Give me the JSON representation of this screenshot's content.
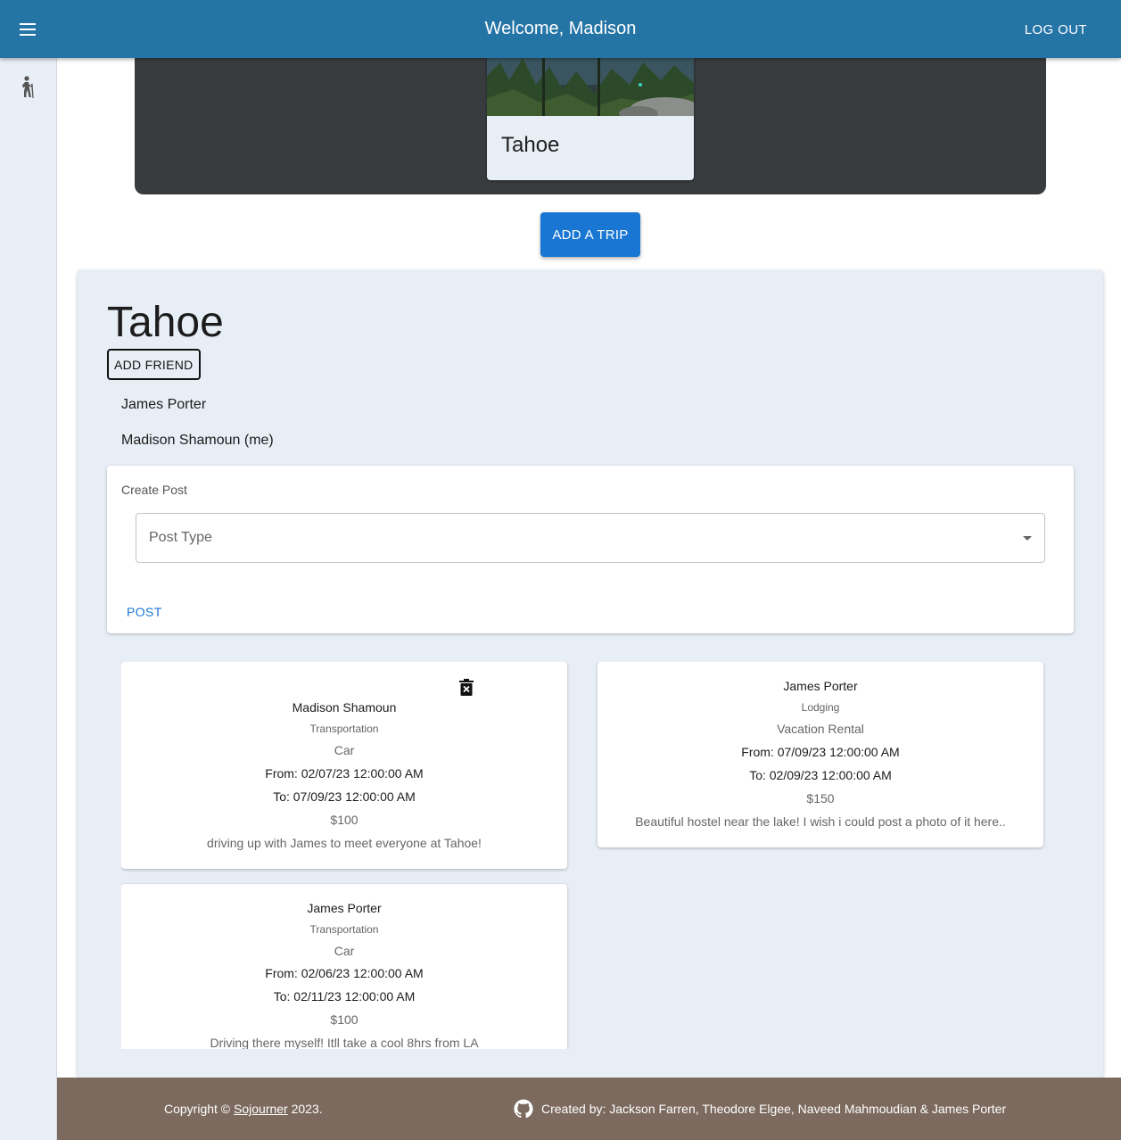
{
  "header": {
    "title": "Welcome, Madison",
    "logout_label": "LOG OUT",
    "accent_color": "#2574a6"
  },
  "sidebar": {
    "icon": "hiking-icon"
  },
  "trips": {
    "cards": [
      {
        "title": "Tahoe",
        "image": "forest-lake-photo"
      }
    ],
    "add_trip_label": "ADD A TRIP"
  },
  "trip": {
    "title": "Tahoe",
    "add_friend_label": "ADD FRIEND",
    "friends": [
      "James Porter",
      "Madison Shamoun (me)"
    ],
    "create_post": {
      "label": "Create Post",
      "post_type_placeholder": "Post Type",
      "post_label": "POST"
    },
    "posts": [
      {
        "author": "Madison Shamoun",
        "type": "Transportation",
        "subtype": "Car",
        "from": "From: 02/07/23 12:00:00 AM",
        "to": "To: 07/09/23 12:00:00 AM",
        "price": "$100",
        "description": "driving up with James to meet everyone at Tahoe!",
        "deletable": true
      },
      {
        "author": "James Porter",
        "type": "Lodging",
        "subtype": "Vacation Rental",
        "from": "From: 07/09/23 12:00:00 AM",
        "to": "To: 02/09/23 12:00:00 AM",
        "price": "$150",
        "description": "Beautiful hostel near the lake! I wish i could post a photo of it here..",
        "deletable": false
      },
      {
        "author": "James Porter",
        "type": "Transportation",
        "subtype": "Car",
        "from": "From: 02/06/23 12:00:00 AM",
        "to": "To: 02/11/23 12:00:00 AM",
        "price": "$100",
        "description": "Driving there myself! Itll take a cool 8hrs from LA",
        "deletable": false
      }
    ]
  },
  "footer": {
    "copyright_prefix": "Copyright ©",
    "brand": "Sojourner",
    "year": "2023.",
    "credits": "Created by: Jackson Farren, Theodore Elgee, Naveed Mahmoudian & James Porter",
    "icon": "github-icon",
    "color": "#7c6a5e"
  }
}
